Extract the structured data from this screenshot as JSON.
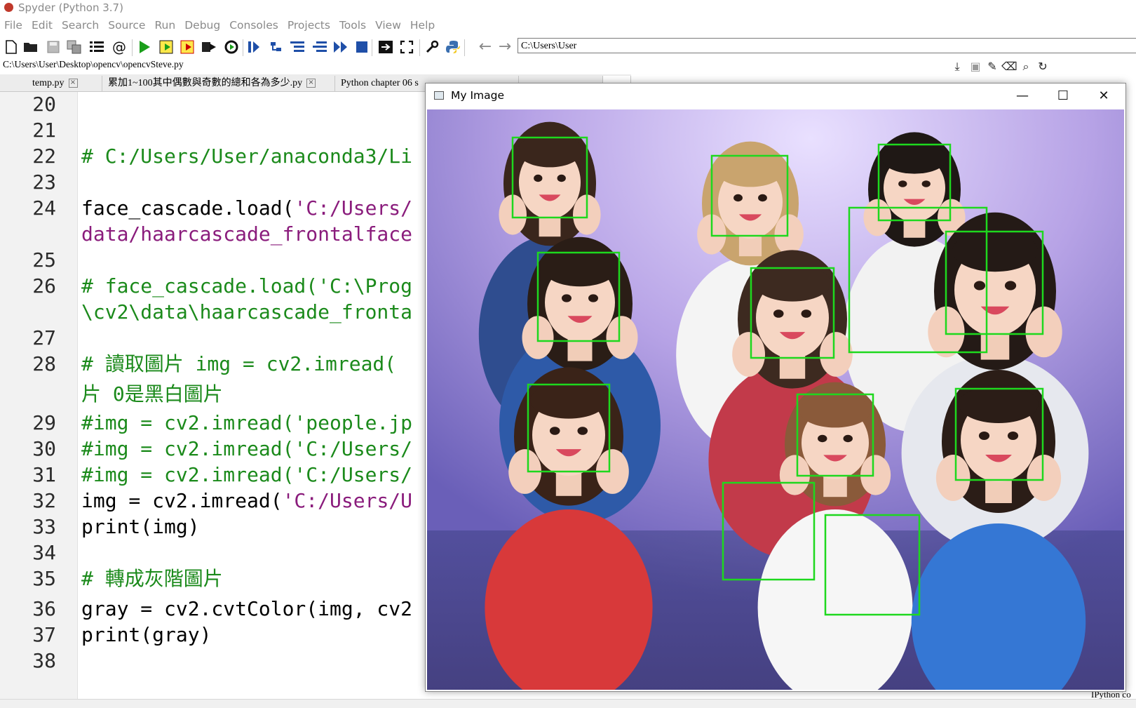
{
  "app": {
    "title": "Spyder (Python 3.7)"
  },
  "menu": [
    "File",
    "Edit",
    "Search",
    "Source",
    "Run",
    "Debug",
    "Consoles",
    "Projects",
    "Tools",
    "View",
    "Help"
  ],
  "toolbar": {
    "working_dir": "C:\\Users\\User"
  },
  "editor": {
    "file_path": "C:\\Users\\User\\Desktop\\opencv\\opencvSteve.py",
    "tabs": [
      {
        "label": "temp.py"
      },
      {
        "label": "累加1~100其中偶數與奇數的總和各為多少.py"
      },
      {
        "label": "Python chapter 06 s"
      },
      {
        "label": ""
      },
      {
        "label": ""
      }
    ],
    "lines": [
      {
        "num": "20",
        "text": "",
        "kind": "plain"
      },
      {
        "num": "21",
        "text": "",
        "kind": "plain"
      },
      {
        "num": "22",
        "text": "# C:/Users/User/anaconda3/Li",
        "kind": "comment"
      },
      {
        "num": "23",
        "text": "",
        "kind": "plain"
      },
      {
        "num": "24",
        "text": "face_cascade.load(",
        "kind": "plain",
        "str": "'C:/Users/"
      },
      {
        "num": "",
        "text": "data/haarcascade_frontalface",
        "kind": "string"
      },
      {
        "num": "25",
        "text": "",
        "kind": "plain"
      },
      {
        "num": "26",
        "text": "# face_cascade.load('C:\\Prog",
        "kind": "comment"
      },
      {
        "num": "",
        "text": "\\cv2\\data\\haarcascade_fronta",
        "kind": "comment"
      },
      {
        "num": "27",
        "text": "",
        "kind": "plain"
      },
      {
        "num": "28",
        "text": "# 讀取圖片 img = cv2.imread(",
        "kind": "comment"
      },
      {
        "num": "",
        "text": "片 0是黑白圖片",
        "kind": "comment"
      },
      {
        "num": "29",
        "text": "#img = cv2.imread('people.jp",
        "kind": "comment"
      },
      {
        "num": "30",
        "text": "#img = cv2.imread('C:/Users/",
        "kind": "comment"
      },
      {
        "num": "31",
        "text": "#img = cv2.imread('C:/Users/",
        "kind": "comment"
      },
      {
        "num": "32",
        "text": "img = cv2.imread(",
        "kind": "plain",
        "str": "'C:/Users/U"
      },
      {
        "num": "33",
        "text": "print(img)",
        "kind": "plain"
      },
      {
        "num": "34",
        "text": "",
        "kind": "plain"
      },
      {
        "num": "35",
        "text": "# 轉成灰階圖片",
        "kind": "comment"
      },
      {
        "num": "36",
        "text": "gray = cv2.cvtColor(img, cv2",
        "kind": "plain"
      },
      {
        "num": "37",
        "text": "print(gray)",
        "kind": "plain"
      },
      {
        "num": "38",
        "text": "",
        "kind": "plain"
      }
    ]
  },
  "image_window": {
    "title": "My Image",
    "controls": {
      "minimize": "—",
      "maximize": "☐",
      "close": "✕"
    },
    "detection_color": "#1ed81e",
    "face_count": 11
  },
  "right_panel": {
    "console_label": "IPython co"
  },
  "colors": {
    "comment": "#1b8a1b",
    "string": "#8a1c7c",
    "run_green": "#1a9e1a"
  }
}
